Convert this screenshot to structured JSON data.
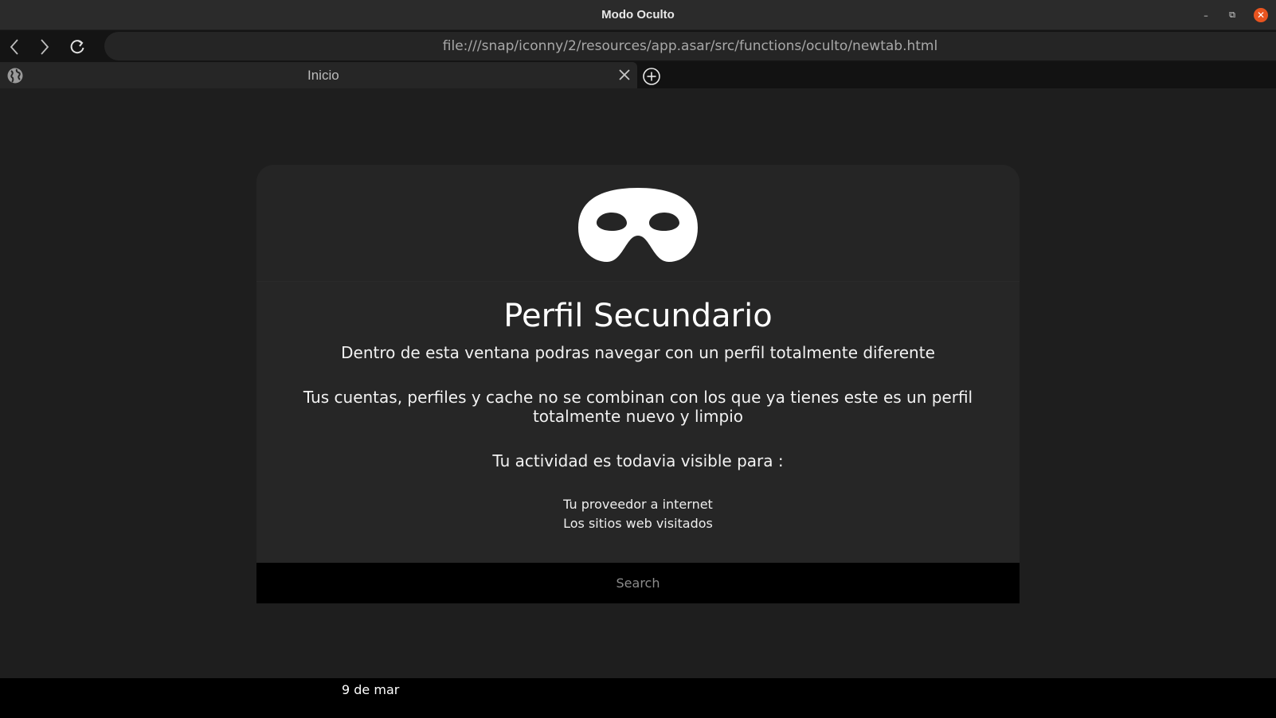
{
  "window": {
    "title": "Modo Oculto",
    "controls": {
      "minimize": "–",
      "maximize": "⧉",
      "close": "✕"
    }
  },
  "navbar": {
    "url": "file:///snap/iconny/2/resources/app.asar/src/functions/oculto/newtab.html",
    "icons": [
      "back-icon",
      "forward-icon",
      "reload-icon"
    ]
  },
  "tabs": [
    {
      "label": "Inicio",
      "icon": "globe-icon",
      "active": true
    }
  ],
  "main": {
    "icon": "incognito-mask-icon",
    "title": "Perfil Secundario",
    "line1": "Dentro de esta ventana podras navegar con un perfil totalmente diferente",
    "line2": "Tus cuentas, perfiles y cache no se combinan con los que ya tienes este es un perfil totalmente nuevo y limpio",
    "line3": "Tu actividad es todavia visible para :",
    "visible_to": [
      "Tu proveedor a internet",
      "Los sitios web visitados"
    ],
    "search_placeholder": "Search"
  },
  "footer": {
    "date": "9 de mar"
  },
  "colors": {
    "background": "#1e1e1e",
    "card": "#262626",
    "close_button": "#e9541f",
    "footer": "#000000"
  }
}
